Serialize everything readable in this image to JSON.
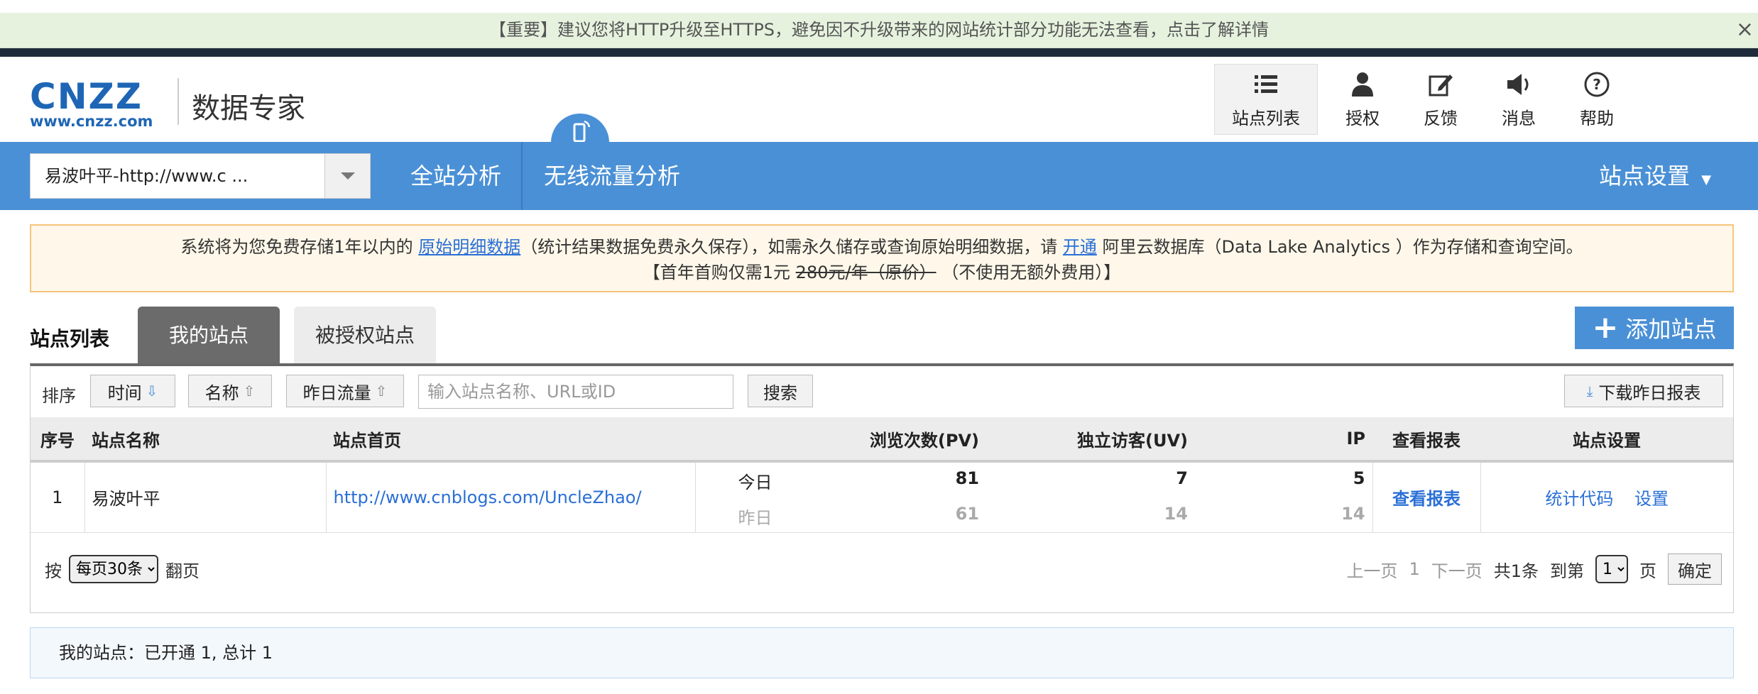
{
  "notice": {
    "text": "【重要】建议您将HTTP升级至HTTPS，避免因不升级带来的网站统计部分功能无法查看，点击了解详情",
    "close": "×"
  },
  "logo": {
    "brand": "CNZZ",
    "url": "www.cnzz.com",
    "sub": "数据专家"
  },
  "top_nav": [
    {
      "label": "站点列表",
      "icon": "list-icon"
    },
    {
      "label": "授权",
      "icon": "user-icon"
    },
    {
      "label": "反馈",
      "icon": "edit-icon"
    },
    {
      "label": "消息",
      "icon": "speaker-icon"
    },
    {
      "label": "帮助",
      "icon": "help-icon"
    }
  ],
  "site_select": {
    "value": "易波叶平-http://www.c ..."
  },
  "main_nav": {
    "all_analysis": "全站分析",
    "wireless": "无线流量分析",
    "settings": "站点设置"
  },
  "info": {
    "line1_a": "系统将为您免费存储1年以内的 ",
    "line1_link1": "原始明细数据",
    "line1_b": "（统计结果数据免费永久保存），如需永久储存或查询原始明细数据，请 ",
    "line1_link2": "开通",
    "line1_c": " 阿里云数据库（Data Lake Analytics ）作为存储和查询空间。",
    "line2_a": "【首年首购仅需1元 ",
    "line2_strike": "280元/年（原价）",
    "line2_b": " （不使用无额外费用）】"
  },
  "tabs": {
    "label": "站点列表",
    "mine": "我的站点",
    "authorized": "被授权站点"
  },
  "add_site": "添加站点",
  "toolbar": {
    "sort_label": "排序",
    "sort_time": "时间",
    "sort_name": "名称",
    "sort_traffic": "昨日流量",
    "search_placeholder": "输入站点名称、URL或ID",
    "search_button": "搜索",
    "download": "下载昨日报表"
  },
  "table": {
    "headers": [
      "序号",
      "站点名称",
      "站点首页",
      "浏览次数(PV)",
      "独立访客(UV)",
      "IP",
      "查看报表",
      "站点设置"
    ],
    "row": {
      "index": "1",
      "name": "易波叶平",
      "url": "http://www.cnblogs.com/UncleZhao/",
      "today_label": "今日",
      "yesterday_label": "昨日",
      "today": {
        "pv": "81",
        "uv": "7",
        "ip": "5"
      },
      "yesterday": {
        "pv": "61",
        "uv": "14",
        "ip": "14"
      },
      "report": "查看报表",
      "code": "统计代码",
      "settings": "设置"
    }
  },
  "pager": {
    "by": "按",
    "per_page": "每页30条",
    "flip": "翻页",
    "prev": "上一页",
    "page": "1",
    "next": "下一页",
    "total": "共1条",
    "goto": "到第",
    "goto_value": "1",
    "page_unit": "页",
    "confirm": "确定"
  },
  "summary": "我的站点：已开通 1, 总计 1",
  "colors": {
    "blue": "#4a90d6",
    "link": "#2a6fd6",
    "notice_bg": "#e6f2de",
    "info_border": "#f5c47a"
  }
}
